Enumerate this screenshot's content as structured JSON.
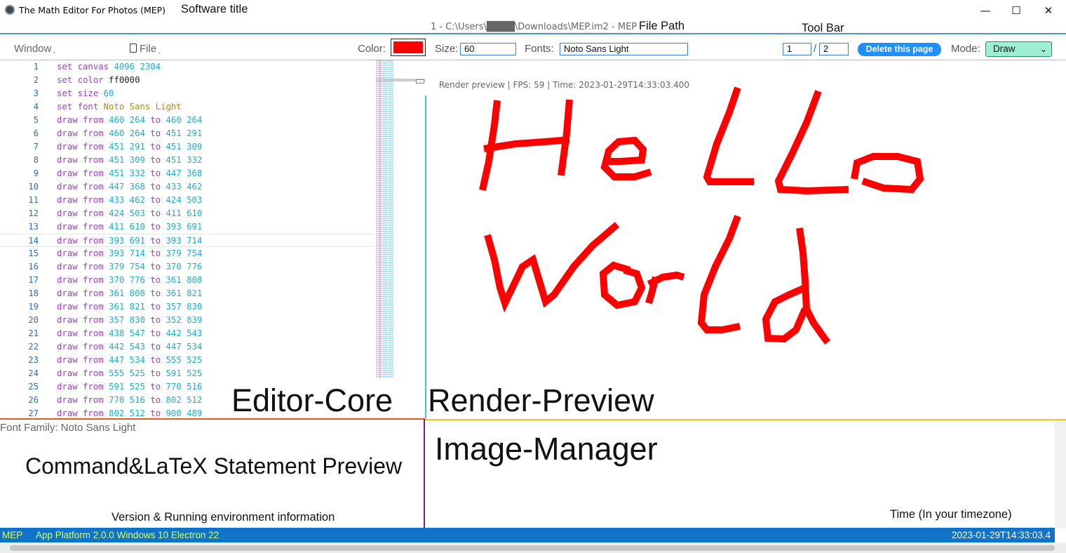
{
  "window": {
    "title": "The Math Editor For Photos (MEP)",
    "title_note": "Software title",
    "minimize": "—",
    "maximize": "☐",
    "close": "✕"
  },
  "path": {
    "text": "1 - C:\\Users\\████\\Downloads\\MEP.im2 - MEP",
    "note": "File Path",
    "toolbar_note": "Tool Bar"
  },
  "toolbar": {
    "window_menu": "Window",
    "file_menu": "File",
    "color_label": "Color:",
    "color_value": "#ff0000",
    "size_label": "Size:",
    "size_value": "60",
    "fonts_label": "Fonts:",
    "fonts_value": "Noto Sans Light",
    "page_current": "1",
    "page_sep": "/",
    "page_total": "2",
    "delete_label": "Delete this page",
    "mode_label": "Mode:",
    "mode_value": "Draw"
  },
  "editor": {
    "lines": [
      [
        [
          "kw",
          "set "
        ],
        [
          "kw",
          "canvas "
        ],
        [
          "num",
          "4096 2304"
        ]
      ],
      [
        [
          "kw",
          "set "
        ],
        [
          "kw",
          "color "
        ],
        [
          "hex",
          "ff0000"
        ]
      ],
      [
        [
          "kw",
          "set "
        ],
        [
          "kw",
          "size "
        ],
        [
          "num",
          "60"
        ]
      ],
      [
        [
          "kw",
          "set "
        ],
        [
          "kw",
          "font "
        ],
        [
          "str",
          "Noto Sans Light"
        ]
      ],
      "460 264 460 264",
      "460 264 451 291",
      "451 291 451 309",
      "451 309 451 332",
      "451 332 447 368",
      "447 368 433 462",
      "433 462 424 503",
      "424 503 411 610",
      "411 610 393 691",
      "393 691 393 714",
      "393 714 379 754",
      "379 754 370 776",
      "370 776 361 808",
      "361 808 361 821",
      "361 821 357 830",
      "357 830 352 839",
      "438 547 442 543",
      "442 543 447 534",
      "447 534 555 525",
      "555 525 591 525",
      "591 525 770 516",
      "770 516 802 512",
      "802 512 900 489"
    ],
    "current_line": 14
  },
  "preview": {
    "info": "Render preview | FPS: 59 | Time: 2023-01-29T14:33:03.400"
  },
  "labels": {
    "editor_core": "Editor-Core",
    "render_preview": "Render-Preview",
    "image_manager": "Image-Manager",
    "statement_preview": "Command&LaTeX Statement Preview",
    "version_note": "Version & Running environment information",
    "time_note": "Time (In your timezone)"
  },
  "statement": {
    "font_family": "Font Family: Noto Sans Light"
  },
  "status": {
    "app": "MEP",
    "platform": "App Platform 2.0.0 Windows 10 Electron 22",
    "time": "2023-01-29T14:33:03.4"
  },
  "colors": {
    "accent": "#0f73c9",
    "stroke": "#ff0000",
    "mode_bg": "#9ef0d0"
  }
}
